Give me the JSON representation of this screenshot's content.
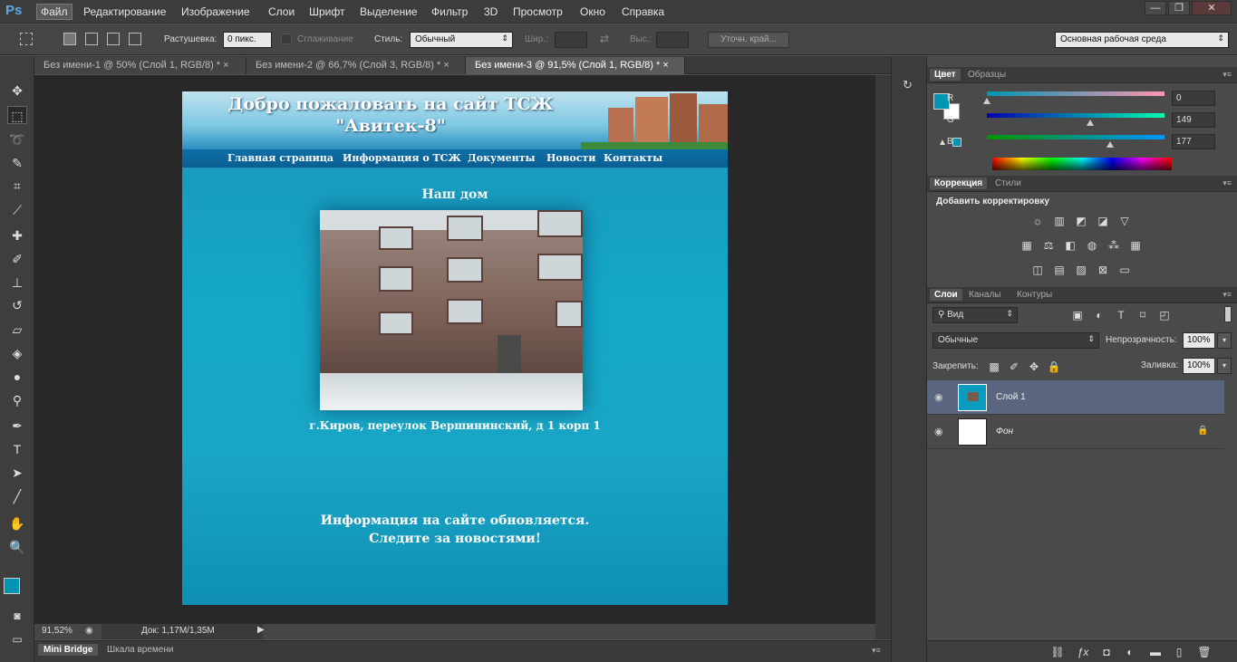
{
  "app": {
    "logo": "Ps"
  },
  "menu": [
    "Файл",
    "Редактирование",
    "Изображение",
    "Слои",
    "Шрифт",
    "Выделение",
    "Фильтр",
    "3D",
    "Просмотр",
    "Окно",
    "Справка"
  ],
  "window_controls": {
    "minimize": "—",
    "restore": "❐",
    "close": "✕"
  },
  "options": {
    "feather_label": "Растушевка:",
    "feather_value": "0 пикс.",
    "antialias_label": "Сглаживание",
    "style_label": "Стиль:",
    "style_value": "Обычный",
    "width_label": "Шир.:",
    "height_label": "Выс.:",
    "refine_button": "Уточн. край...",
    "workspace": "Основная рабочая среда"
  },
  "tabs": [
    {
      "label": "Без имени-1 @ 50% (Слой 1, RGB/8) *"
    },
    {
      "label": "Без имени-2 @ 66,7% (Слой 3, RGB/8) *"
    },
    {
      "label": "Без имени-3 @ 91,5% (Слой 1, RGB/8) *"
    }
  ],
  "tab_close": "×",
  "document": {
    "title_line1": "Добро пожаловать на сайт ТСЖ",
    "title_line2": "\"Авитек-8\"",
    "nav": [
      "Главная страница",
      "Информация о ТСЖ",
      "Документы",
      "Новости",
      "Контакты"
    ],
    "home_heading": "Наш дом",
    "address": "г.Киров, переулок Вершининский, д 1 корп 1",
    "info_line1": "Информация на сайте обновляется.",
    "info_line2": "Следите за новостями!"
  },
  "status": {
    "zoom": "91,52%",
    "doc_info": "Док: 1,17M/1,35M"
  },
  "bottom_tabs": [
    "Mini Bridge",
    "Шкала времени"
  ],
  "color_panel": {
    "tabs": [
      "Цвет",
      "Образцы"
    ],
    "r_label": "R",
    "g_label": "G",
    "b_label": "B",
    "r": "0",
    "g": "149",
    "b": "177",
    "foreground": "#0095b1"
  },
  "adjust_panel": {
    "tabs": [
      "Коррекция",
      "Стили"
    ],
    "heading": "Добавить корректировку"
  },
  "layers_panel": {
    "tabs": [
      "Слои",
      "Каналы",
      "Контуры"
    ],
    "filter": "Вид",
    "blend_mode": "Обычные",
    "opacity_label": "Непрозрачность:",
    "opacity": "100%",
    "lock_label": "Закрепить:",
    "fill_label": "Заливка:",
    "fill": "100%",
    "layers": [
      {
        "name": "Слой 1",
        "selected": true
      },
      {
        "name": "Фон",
        "selected": false
      }
    ]
  }
}
